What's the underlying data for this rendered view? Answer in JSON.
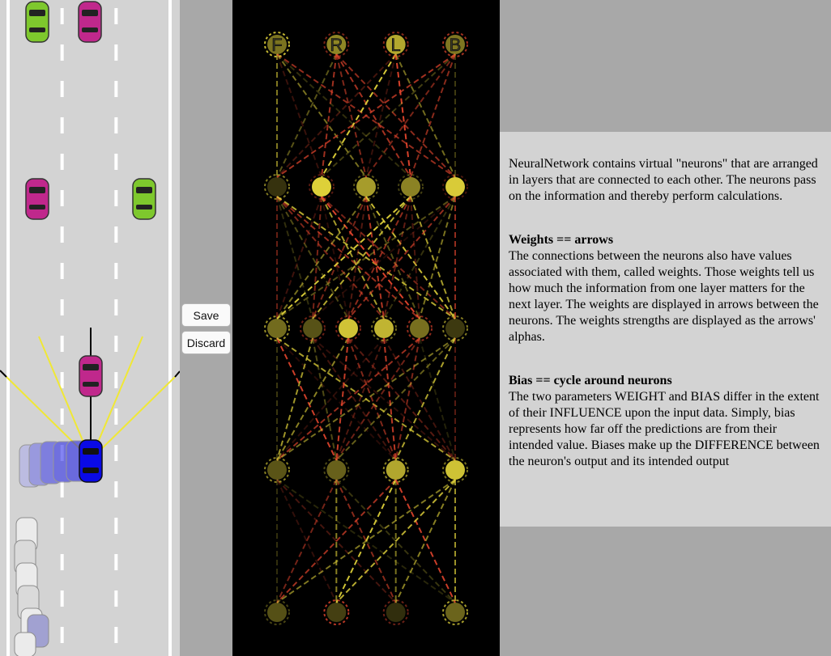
{
  "controls": {
    "save_label": "Save",
    "discard_label": "Discard"
  },
  "network": {
    "output_labels": [
      "F",
      "R",
      "L",
      "B"
    ],
    "layer_sizes": [
      4,
      4,
      6,
      5,
      4
    ],
    "colors": {
      "positive": "#e0d23a",
      "negative": "#e0442c",
      "background": "#000000"
    }
  },
  "road": {
    "lane_count": 3,
    "colors": {
      "road": "#d3d3d3",
      "lane_line": "#ffffff",
      "sensor": "#f0e835",
      "player_car": "#0a0ae6",
      "traffic_pink": "#c0288c",
      "traffic_green": "#7ec82d",
      "ghost_car": "#c8c8c8"
    }
  },
  "info": {
    "intro": "NeuralNetwork contains virtual \"neurons\" that are arranged in layers that are connected to each other. The neurons pass on the information and thereby perform calculations.",
    "weights_title": "Weights == arrows",
    "weights_text": "The connections between the neurons also have values associated with them, called weights. Those weights tell us how much the information from one layer matters for the next layer. The weights are displayed in arrows between the neurons. The weights strengths are displayed as the arrows' alphas.",
    "bias_title": "Bias == cycle around neurons",
    "bias_text": "The two parameters WEIGHT and BIAS differ in the extent of their INFLUENCE upon the input data. Simply, bias represents how far off the predictions are from their intended value. Biases make up the DIFFERENCE between the neuron's output and its intended output"
  }
}
